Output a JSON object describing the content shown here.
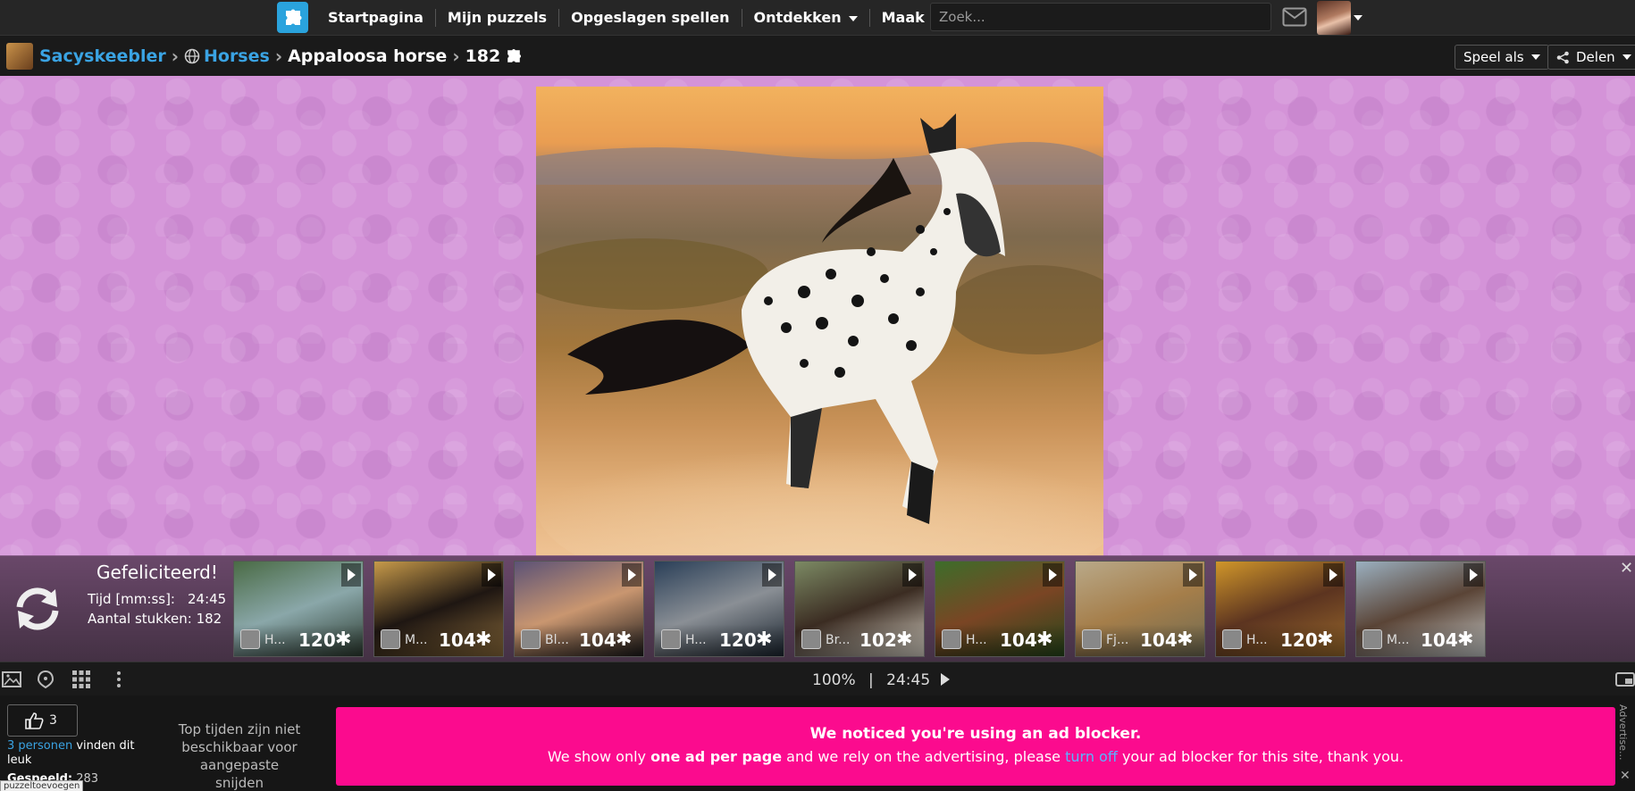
{
  "nav": {
    "items": [
      {
        "label": "Startpagina"
      },
      {
        "label": "Mijn puzzels"
      },
      {
        "label": "Opgeslagen spellen"
      },
      {
        "label": "Ontdekken"
      },
      {
        "label": "Maak"
      }
    ],
    "search_placeholder": "Zoek..."
  },
  "breadcrumb": {
    "user": "Sacyskeebler",
    "category": "Horses",
    "title": "Appaloosa horse",
    "pieces": "182"
  },
  "actions": {
    "play_as": "Speel als",
    "share": "Delen"
  },
  "result": {
    "title": "Gefeliciteerd!",
    "time_label": "Tijd [mm:ss]:",
    "time_value": "24:45",
    "pieces_label": "Aantal stukken: 182"
  },
  "related": [
    {
      "name": "H...",
      "count": "120",
      "colors": [
        "#4a6b45",
        "#8aa7a9",
        "#2c3b30"
      ]
    },
    {
      "name": "M...",
      "count": "104",
      "colors": [
        "#c79a4a",
        "#1e1612",
        "#8a6a3a"
      ]
    },
    {
      "name": "Bl...",
      "count": "104",
      "colors": [
        "#5c5276",
        "#c99670",
        "#1c1a1a"
      ]
    },
    {
      "name": "H...",
      "count": "120",
      "colors": [
        "#2a3f58",
        "#8a8f95",
        "#1b2530"
      ]
    },
    {
      "name": "Br...",
      "count": "102",
      "colors": [
        "#7c8a64",
        "#3b2c22",
        "#d8d2c6"
      ]
    },
    {
      "name": "H...",
      "count": "104",
      "colors": [
        "#3d6d2a",
        "#7a4524",
        "#25461a"
      ]
    },
    {
      "name": "Fj...",
      "count": "104",
      "colors": [
        "#b9a989",
        "#a57e4a",
        "#6e6a52"
      ]
    },
    {
      "name": "H...",
      "count": "120",
      "colors": [
        "#d0962a",
        "#5c3420",
        "#9a6a2c"
      ]
    },
    {
      "name": "M...",
      "count": "104",
      "colors": [
        "#9bb0c0",
        "#5a4436",
        "#c6c9c8"
      ]
    }
  ],
  "toolbar": {
    "zoom": "100%",
    "separator": "|",
    "time": "24:45"
  },
  "footer": {
    "like_count": "3",
    "like_link": "3 personen",
    "like_text": " vinden dit leuk",
    "played_label": "Gespeeld:",
    "played_value": "283",
    "top_times": "Top tijden zijn niet beschikbaar voor aangepaste snijden",
    "ad_title": "We noticed you're using an ad blocker.",
    "ad_text_1": "We show only ",
    "ad_text_bold": "one ad per page",
    "ad_text_2": " and we rely on the advertising, please ",
    "ad_link": "turn off",
    "ad_text_3": " your ad blocker for this site, thank you.",
    "ad_side": "Advertise...",
    "tooltip": "puzzeltoevoegen"
  },
  "colors": {
    "accent": "#3aa3e3",
    "logo": "#2aa3dd",
    "play_bg": "#d493d8",
    "ad_bg": "#fb0b8e"
  }
}
